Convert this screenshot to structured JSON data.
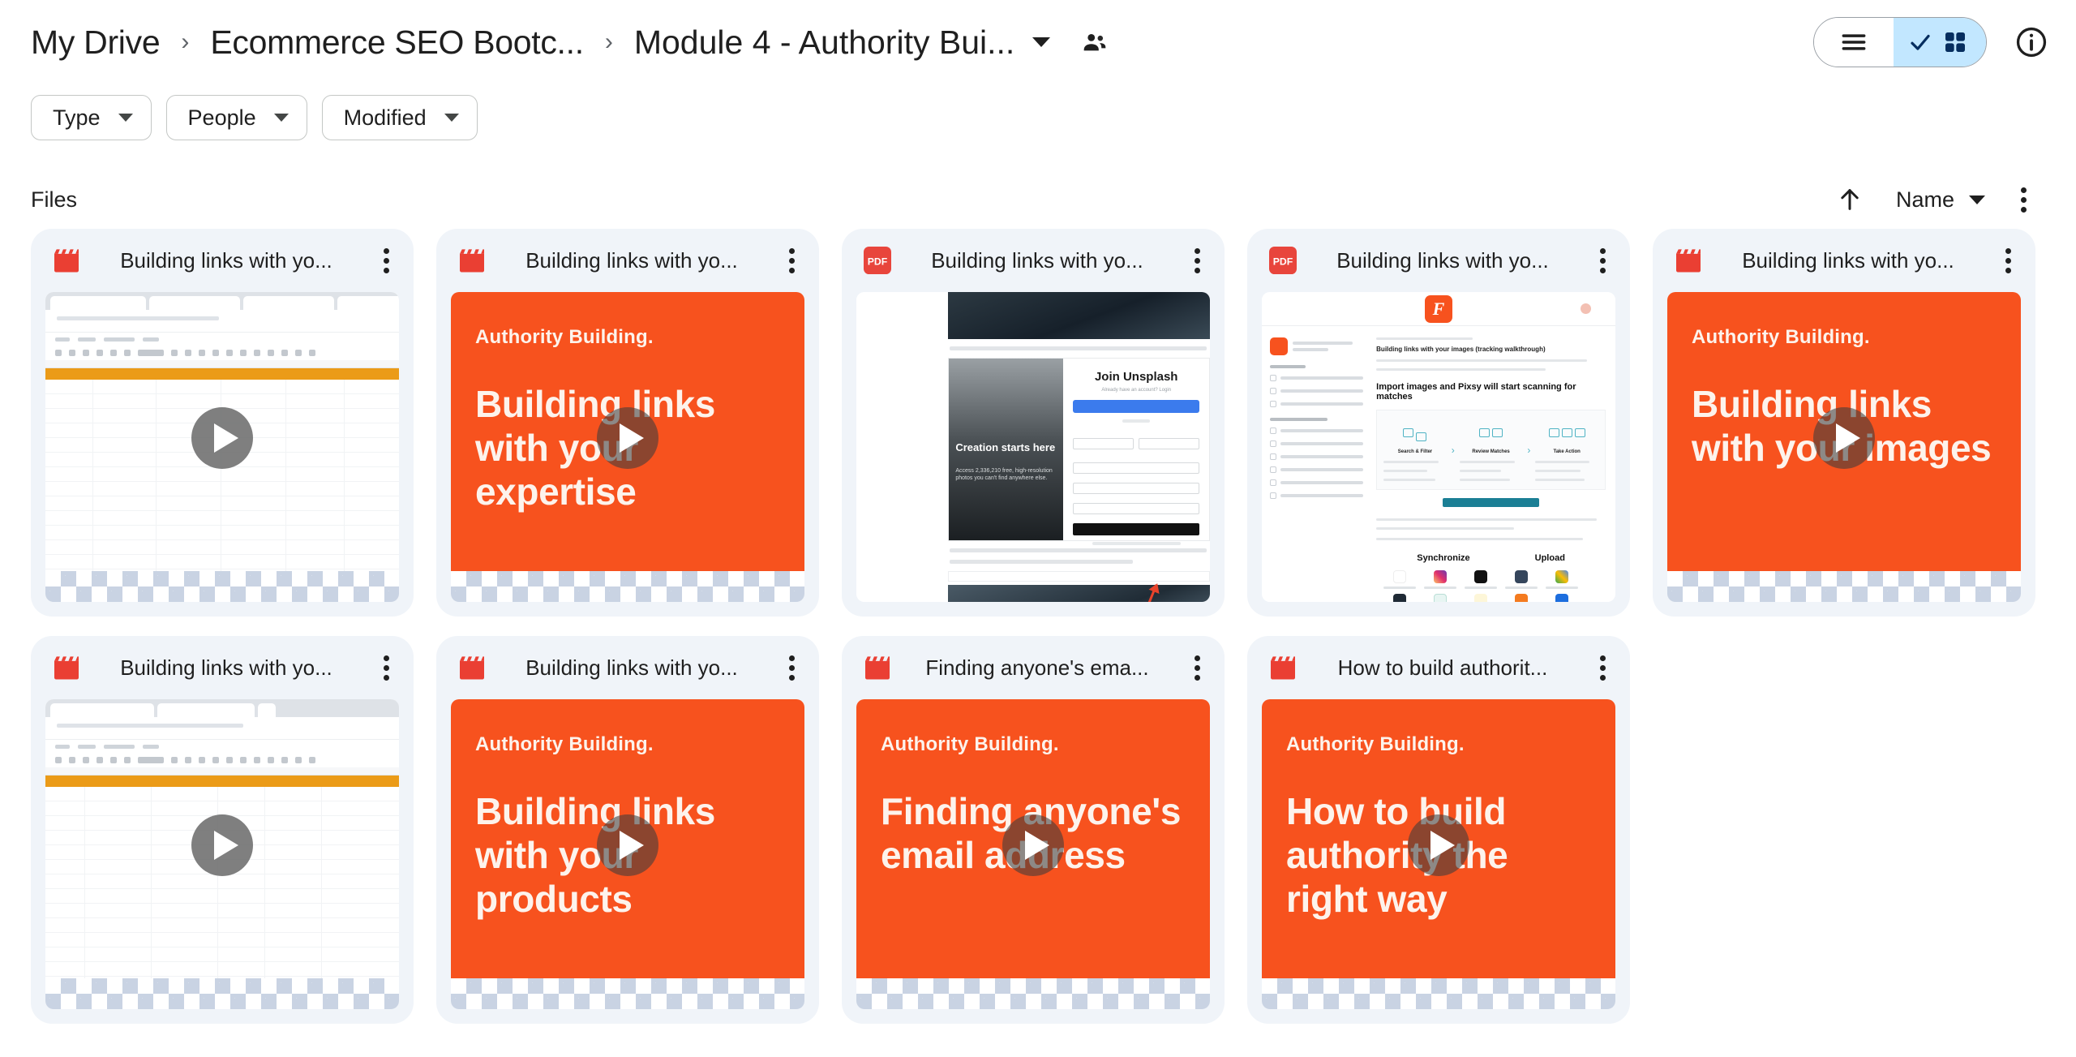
{
  "header": {
    "breadcrumb": [
      {
        "label": "My Drive"
      },
      {
        "label": "Ecommerce SEO Bootc..."
      },
      {
        "label": "Module 4 - Authority Bui..."
      }
    ],
    "separator": "›",
    "folder_dropdown_icon": "chevron-down-icon",
    "share_icon": "people-icon",
    "view_toggle": {
      "list_label": "list-view",
      "grid_label": "grid-view",
      "selected": "grid-view",
      "selected_bg": "#c2e7ff"
    },
    "info_icon": "info-icon"
  },
  "filters": [
    {
      "label": "Type"
    },
    {
      "label": "People"
    },
    {
      "label": "Modified"
    }
  ],
  "section": {
    "title": "Files",
    "sort_direction_icon": "arrow-up-icon",
    "sort_by_label": "Name",
    "more_icon": "kebab-menu-icon"
  },
  "theme": {
    "card_bg": "#f0f4f9",
    "slide_orange": "#f7521e",
    "slide_text": "#fdf3ec",
    "video_icon_red": "#ea3f33",
    "pdf_icon_red": "#e8453c",
    "sheet_header_orange": "#eb9b18"
  },
  "files": [
    {
      "title": "Building links with yo...",
      "icon": "video-clapperboard-icon",
      "type": "video",
      "thumb": "sheets"
    },
    {
      "title": "Building links with yo...",
      "icon": "video-clapperboard-icon",
      "type": "video",
      "thumb": "slide",
      "slide_kicker": "Authority Building.",
      "slide_title": "Building links with your expertise"
    },
    {
      "title": "Building links with yo...",
      "icon": "pdf-icon",
      "icon_text": "PDF",
      "type": "pdf",
      "thumb": "pdf-unsplash"
    },
    {
      "title": "Building links with yo...",
      "icon": "pdf-icon",
      "icon_text": "PDF",
      "type": "pdf",
      "thumb": "pdf-course"
    },
    {
      "title": "Building links with yo...",
      "icon": "video-clapperboard-icon",
      "type": "video",
      "thumb": "slide",
      "slide_kicker": "Authority Building.",
      "slide_title": "Building links with your images"
    },
    {
      "title": "Building links with yo...",
      "icon": "video-clapperboard-icon",
      "type": "video",
      "thumb": "sheets"
    },
    {
      "title": "Building links with yo...",
      "icon": "video-clapperboard-icon",
      "type": "video",
      "thumb": "slide",
      "slide_kicker": "Authority Building.",
      "slide_title": "Building links with your products"
    },
    {
      "title": "Finding anyone's ema...",
      "icon": "video-clapperboard-icon",
      "type": "video",
      "thumb": "slide",
      "slide_kicker": "Authority Building.",
      "slide_title": "Finding anyone's email address"
    },
    {
      "title": "How to build authorit...",
      "icon": "video-clapperboard-icon",
      "type": "video",
      "thumb": "slide",
      "slide_kicker": "Authority Building.",
      "slide_title": "How to build authority the right way"
    }
  ],
  "pdf_unsplash": {
    "heading": "Join Unsplash",
    "hero_text": "Creation starts here"
  },
  "pdf_course": {
    "doc_title": "Building links with your images (tracking walkthrough)",
    "banner": "Import images and Pixsy will start scanning for matches",
    "steps": [
      "Search & Filter",
      "Review Matches",
      "Take Action"
    ],
    "sections": [
      "Synchronize",
      "Upload"
    ]
  }
}
